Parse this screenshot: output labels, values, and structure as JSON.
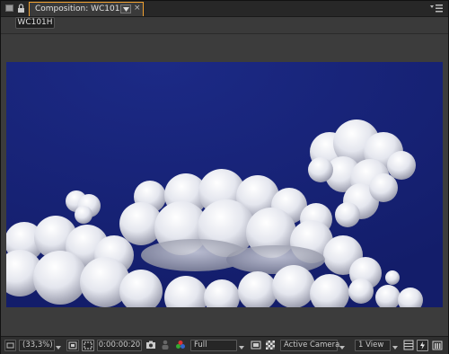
{
  "panel": {
    "tab_title": "Composition: WC101H",
    "close_glyph": "×",
    "breadcrumb": "WC101H"
  },
  "toolbar": {
    "magnification": "(33,3%)",
    "timecode": "0:00:00:20",
    "resolution": "Full",
    "camera": "Active Camera",
    "views": "1 View"
  },
  "icons": [
    "panel-grip-icon",
    "lock-icon",
    "tab-dropdown-icon",
    "panel-menu-icon",
    "comp-mini-flowchart-icon",
    "magnification-arrow-icon",
    "safe-zones-icon",
    "mask-visibility-icon",
    "snapshot-icon",
    "show-snapshot-icon",
    "color-channels-icon",
    "region-of-interest-icon",
    "transparency-grid-icon",
    "toggle-view-icon",
    "fast-preview-icon",
    "timeline-icon",
    "flowchart-icon"
  ],
  "colors": {
    "accent": "#f0a030",
    "panel_bg": "#3a3a3a",
    "sky": "#162074"
  }
}
